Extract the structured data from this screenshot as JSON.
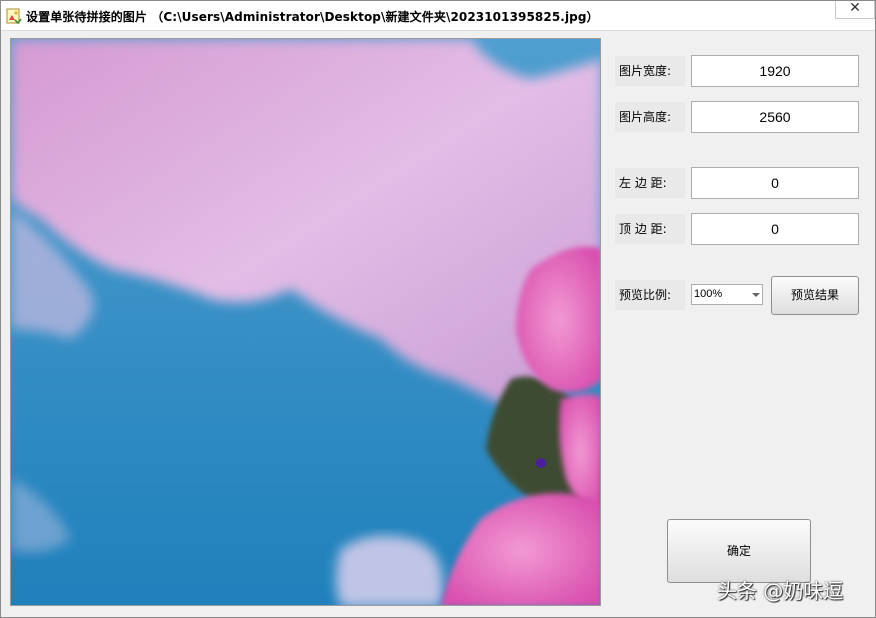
{
  "window": {
    "title": "设置单张待拼接的图片",
    "file_path": "（C:\\Users\\Administrator\\Desktop\\新建文件夹\\2023101395825.jpg）",
    "close_glyph": "✕"
  },
  "fields": {
    "width_label": "图片宽度:",
    "width_value": "1920",
    "height_label": "图片高度:",
    "height_value": "2560",
    "left_margin_label": "左 边 距:",
    "left_margin_value": "0",
    "top_margin_label": "顶 边 距:",
    "top_margin_value": "0"
  },
  "preview_scale": {
    "label": "预览比例:",
    "selected": "100%"
  },
  "buttons": {
    "preview_result": "预览结果",
    "confirm": "确定"
  },
  "watermark": "头条 @奶味逗",
  "icons": {
    "app": "image-file-icon",
    "dropdown": "chevron-down-icon"
  },
  "colors": {
    "sky_blue": "#2c8cc0",
    "cloud_pink": "#d9a6d8",
    "flower_pink": "#e063b8",
    "leaf_green": "#3a4a32"
  }
}
